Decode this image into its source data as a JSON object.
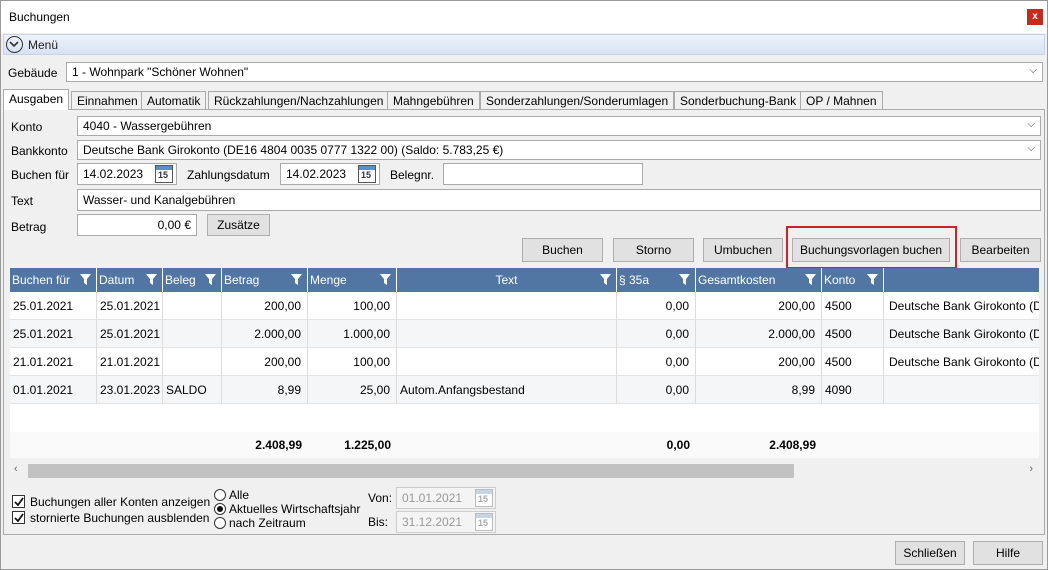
{
  "window": {
    "title": "Buchungen",
    "close": "x"
  },
  "menu": {
    "label": "Menü"
  },
  "building": {
    "label": "Gebäude",
    "value": "1 - Wohnpark \"Schöner Wohnen\""
  },
  "tabs": [
    "Ausgaben",
    "Einnahmen",
    "Automatik",
    "Rückzahlungen/Nachzahlungen",
    "Mahngebühren",
    "Sonderzahlungen/Sonderumlagen",
    "Sonderbuchung-Bank",
    "OP / Mahnen"
  ],
  "form": {
    "konto_label": "Konto",
    "konto_value": "4040 - Wassergebühren",
    "bankkonto_label": "Bankkonto",
    "bankkonto_value": "Deutsche Bank Girokonto (DE16 4804 0035 0777 1322 00) (Saldo: 5.783,25 €)",
    "buchen_fuer_label": "Buchen für",
    "buchen_fuer_value": "14.02.2023",
    "zahlungsdatum_label": "Zahlungsdatum",
    "zahlungsdatum_value": "14.02.2023",
    "belegnr_label": "Belegnr.",
    "belegnr_value": "",
    "text_label": "Text",
    "text_value": "Wasser- und Kanalgebühren",
    "betrag_label": "Betrag",
    "betrag_value": "0,00 €",
    "zusaetze": "Zusätze",
    "calendar_day": "15"
  },
  "actions": {
    "buchen": "Buchen",
    "storno": "Storno",
    "umbuchen": "Umbuchen",
    "vorlagen": "Buchungsvorlagen buchen",
    "bearbeiten": "Bearbeiten"
  },
  "grid": {
    "columns": [
      "Buchen für",
      "Datum",
      "Beleg",
      "Betrag",
      "Menge",
      "Text",
      "§ 35a",
      "Gesamtkosten",
      "Konto",
      ""
    ],
    "rows": [
      [
        "25.01.2021",
        "25.01.2021",
        "",
        "200,00",
        "100,00",
        "",
        "0,00",
        "200,00",
        "4500",
        "Deutsche Bank Girokonto (D"
      ],
      [
        "25.01.2021",
        "25.01.2021",
        "",
        "2.000,00",
        "1.000,00",
        "",
        "0,00",
        "2.000,00",
        "4500",
        "Deutsche Bank Girokonto (D"
      ],
      [
        "21.01.2021",
        "21.01.2021",
        "",
        "200,00",
        "100,00",
        "",
        "0,00",
        "200,00",
        "4500",
        "Deutsche Bank Girokonto (D"
      ],
      [
        "01.01.2021",
        "23.01.2023",
        "SALDO",
        "8,99",
        "25,00",
        "Autom.Anfangsbestand",
        "0,00",
        "8,99",
        "4090",
        ""
      ]
    ],
    "totals": {
      "betrag": "2.408,99",
      "menge": "1.225,00",
      "s35a": "0,00",
      "gesamt": "2.408,99"
    }
  },
  "options": {
    "show_all": "Buchungen aller Konten anzeigen",
    "hide_storno": "stornierte Buchungen ausblenden",
    "radio_all": "Alle",
    "radio_current": "Aktuelles Wirtschaftsjahr",
    "radio_range": "nach Zeitraum",
    "von_label": "Von:",
    "von_value": "01.01.2021",
    "bis_label": "Bis:",
    "bis_value": "31.12.2021"
  },
  "footer": {
    "close": "Schließen",
    "help": "Hilfe"
  }
}
